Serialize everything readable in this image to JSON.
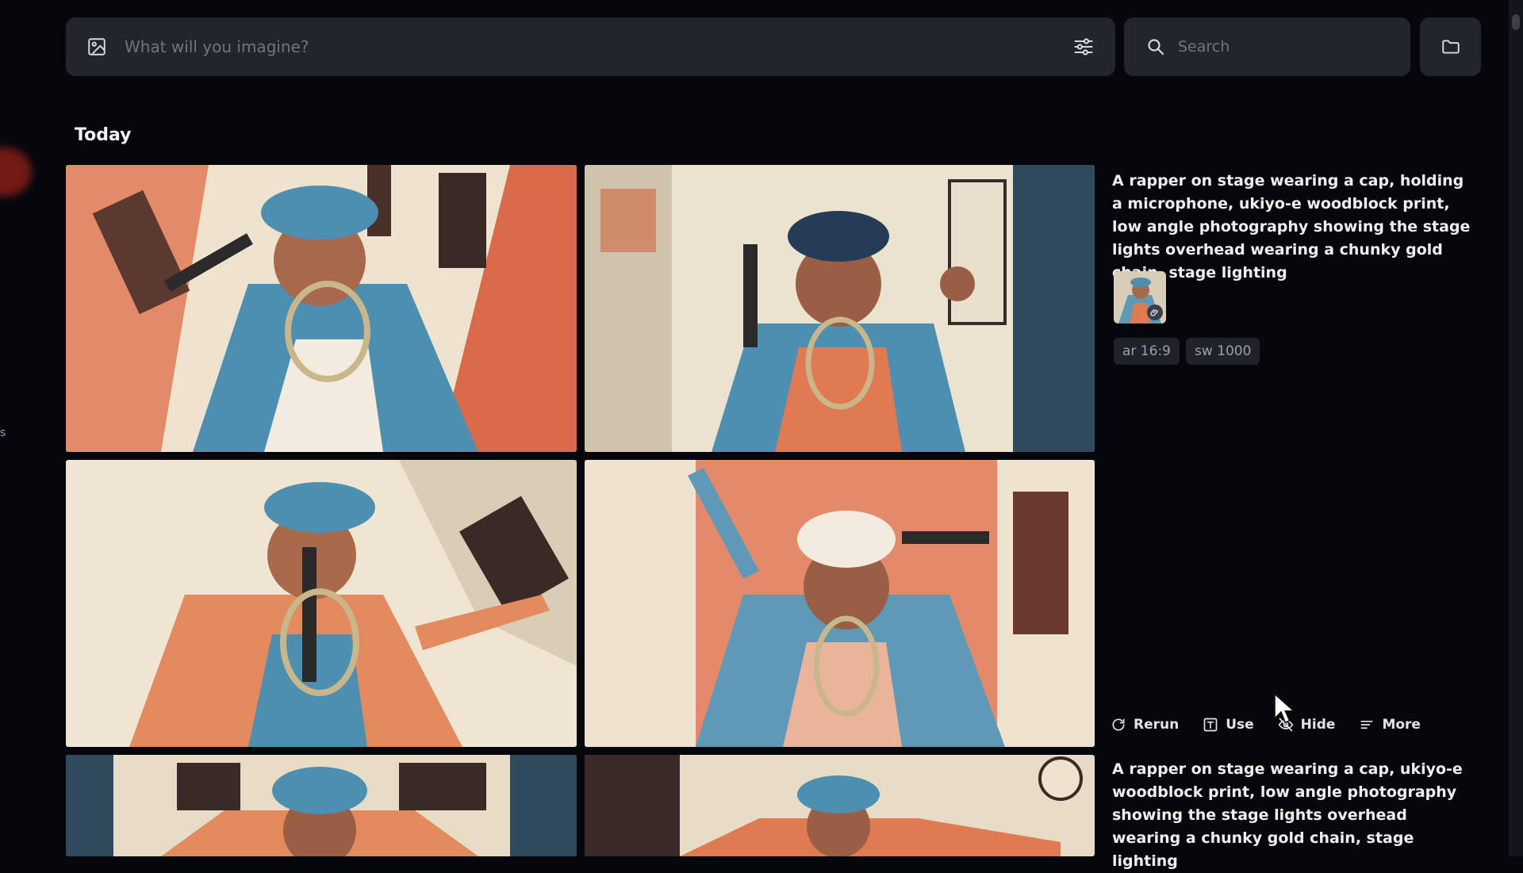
{
  "top_bar": {
    "prompt_placeholder": "What will you imagine?",
    "search_placeholder": "Search"
  },
  "section_label": "Today",
  "generation_1": {
    "prompt": "A rapper on stage wearing a cap, holding a microphone, ukiyo-e woodblock print, low angle photography showing the stage lights overhead wearing a chunky gold chain, stage lighting",
    "params": [
      "ar 16:9",
      "sw 1000"
    ]
  },
  "actions": {
    "rerun": "Rerun",
    "use": "Use",
    "hide": "Hide",
    "more": "More"
  },
  "generation_2": {
    "prompt": "A rapper on stage wearing a cap, ukiyo-e woodblock print, low angle photography showing the stage lights overhead wearing a chunky gold chain, stage lighting"
  },
  "colors": {
    "background": "#05070d",
    "panel": "#22252c",
    "accent_orange": "#e07a52",
    "accent_blue": "#4d8fb0",
    "paper": "#efe6d4"
  }
}
